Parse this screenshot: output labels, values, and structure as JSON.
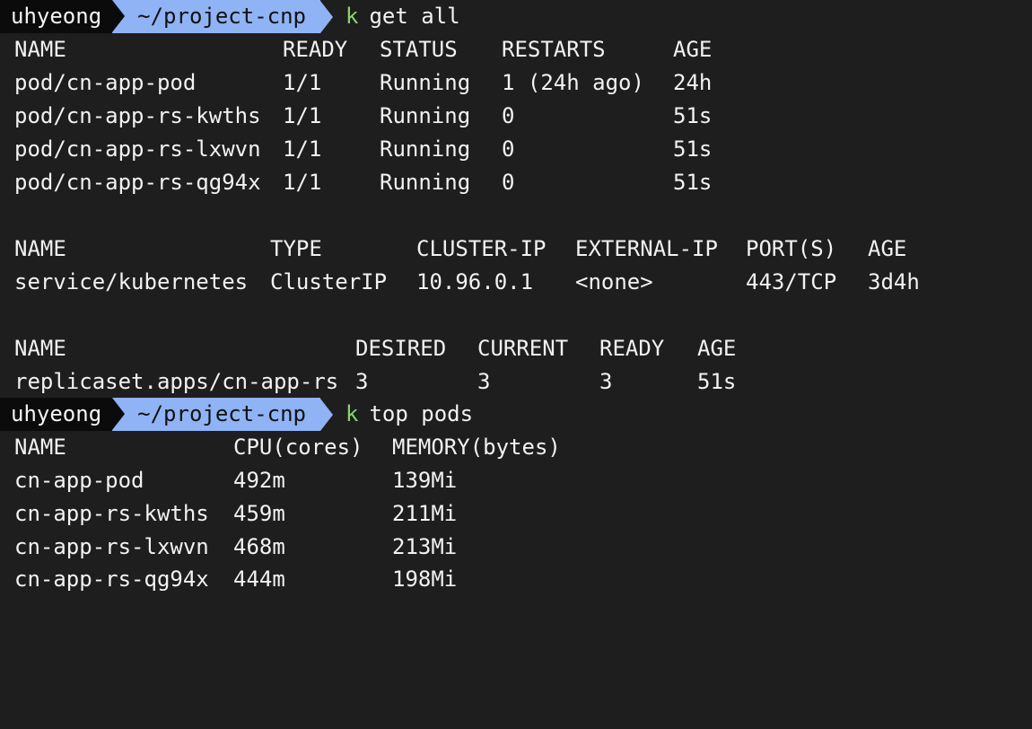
{
  "prompt1": {
    "user": "uhyeong",
    "path": "~/project-cnp",
    "cmd_alias": "k",
    "cmd_args": "get all"
  },
  "pods_table": {
    "headers": [
      "NAME",
      "READY",
      "STATUS",
      "RESTARTS",
      "AGE"
    ],
    "rows": [
      [
        "pod/cn-app-pod",
        "1/1",
        "Running",
        "1 (24h ago)",
        "24h"
      ],
      [
        "pod/cn-app-rs-kwths",
        "1/1",
        "Running",
        "0",
        "51s"
      ],
      [
        "pod/cn-app-rs-lxwvn",
        "1/1",
        "Running",
        "0",
        "51s"
      ],
      [
        "pod/cn-app-rs-qg94x",
        "1/1",
        "Running",
        "0",
        "51s"
      ]
    ]
  },
  "services_table": {
    "headers": [
      "NAME",
      "TYPE",
      "CLUSTER-IP",
      "EXTERNAL-IP",
      "PORT(S)",
      "AGE"
    ],
    "rows": [
      [
        "service/kubernetes",
        "ClusterIP",
        "10.96.0.1",
        "<none>",
        "443/TCP",
        "3d4h"
      ]
    ]
  },
  "replicasets_table": {
    "headers": [
      "NAME",
      "DESIRED",
      "CURRENT",
      "READY",
      "AGE"
    ],
    "rows": [
      [
        "replicaset.apps/cn-app-rs",
        "3",
        "3",
        "3",
        "51s"
      ]
    ]
  },
  "prompt2": {
    "user": "uhyeong",
    "path": "~/project-cnp",
    "cmd_alias": "k",
    "cmd_args": "top pods"
  },
  "top_table": {
    "headers": [
      "NAME",
      "CPU(cores)",
      "MEMORY(bytes)"
    ],
    "rows": [
      [
        "cn-app-pod",
        "492m",
        "139Mi"
      ],
      [
        "cn-app-rs-kwths",
        "459m",
        "211Mi"
      ],
      [
        "cn-app-rs-lxwvn",
        "468m",
        "213Mi"
      ],
      [
        "cn-app-rs-qg94x",
        "444m",
        "198Mi"
      ]
    ]
  },
  "colors": {
    "background": "#1e1e1e",
    "text": "#f2f2f2",
    "prompt_user_bg": "#0b0b0b",
    "prompt_path_bg": "#8fb3f5",
    "command_alias": "#8bd36b"
  }
}
